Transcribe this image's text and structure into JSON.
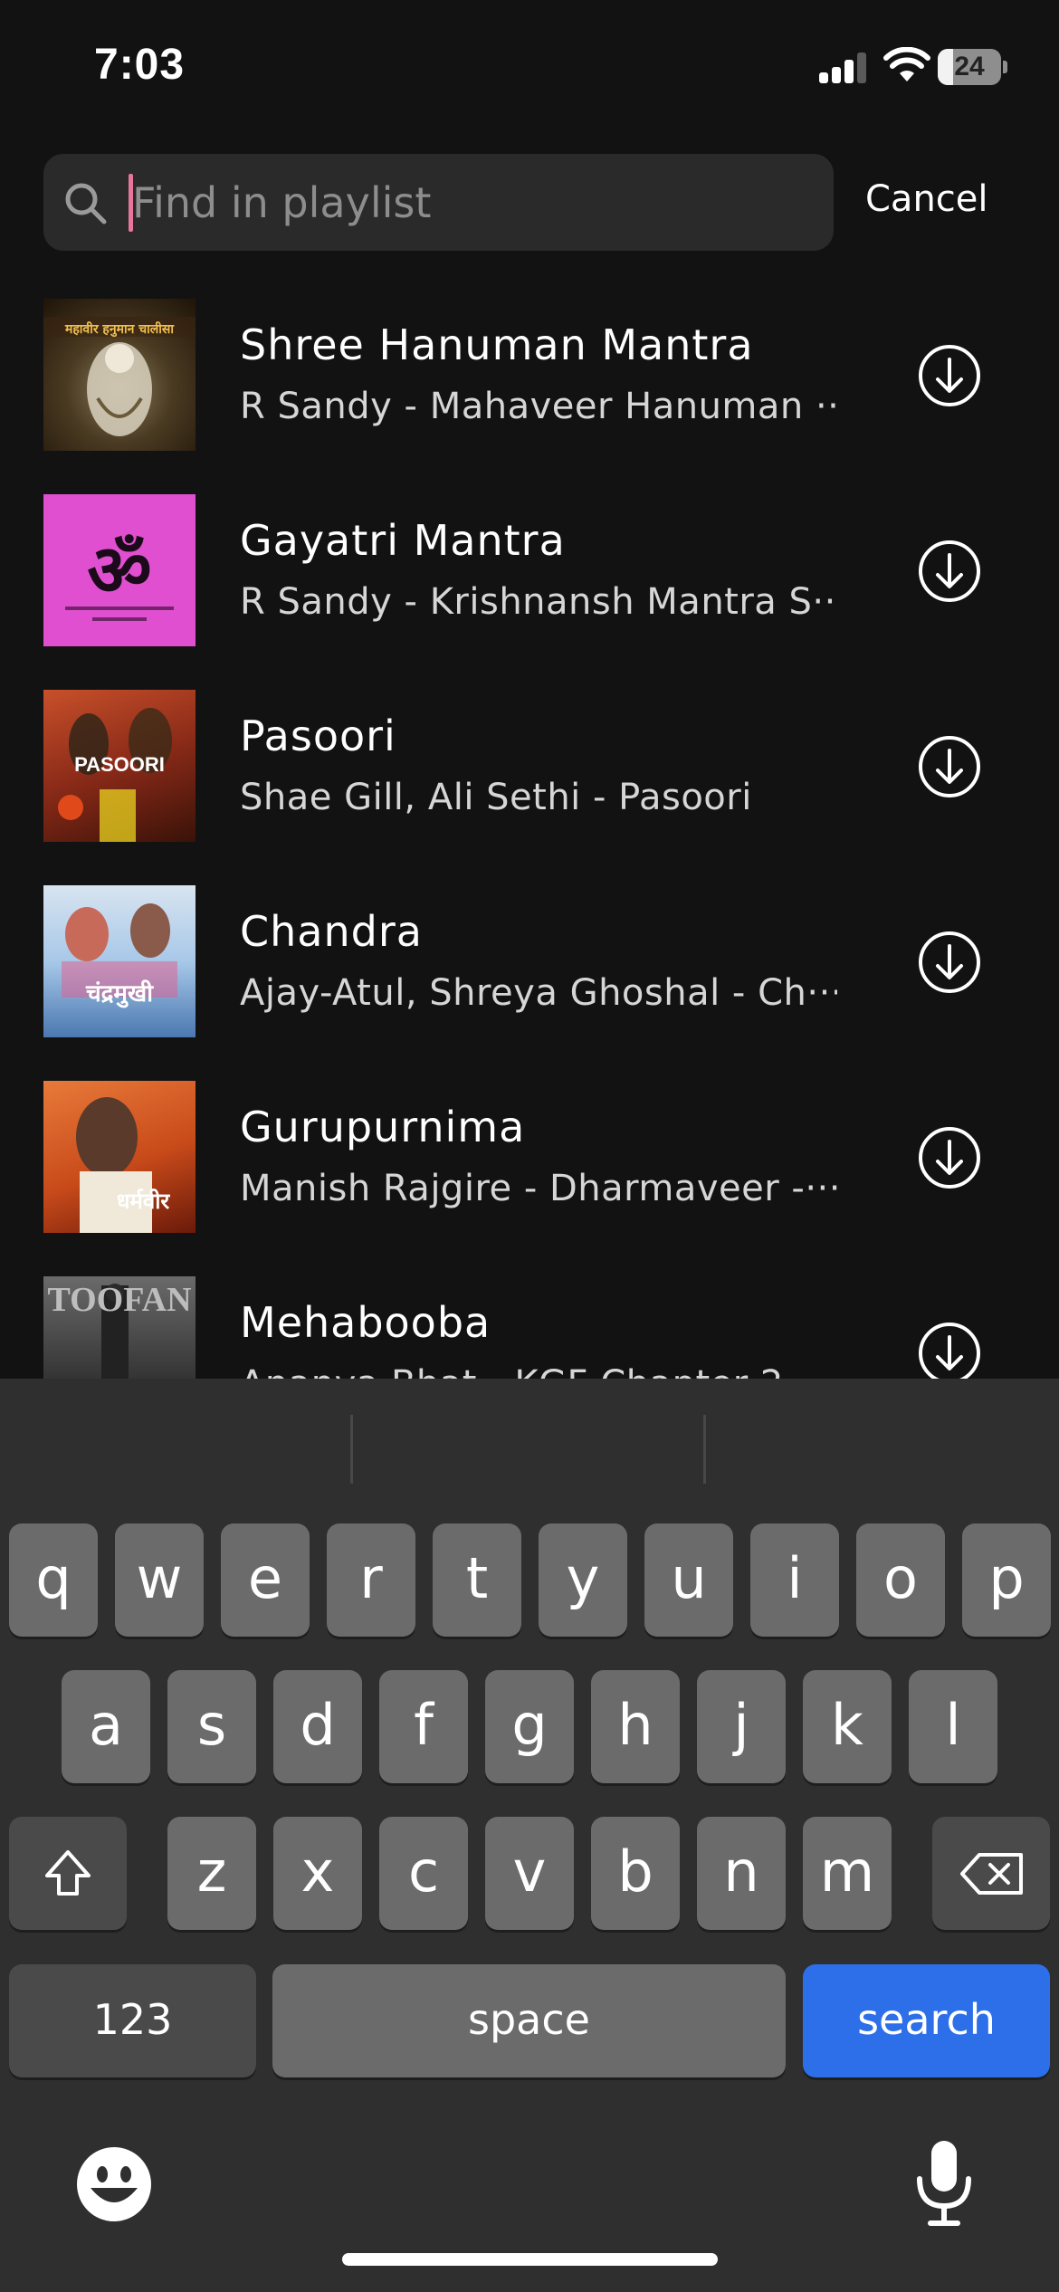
{
  "status_bar": {
    "time": "7:03",
    "battery": "24",
    "battery_level": 0.24
  },
  "search": {
    "placeholder": "Find in playlist",
    "value": "",
    "cancel_label": "Cancel"
  },
  "tracks": [
    {
      "title": "Shree Hanuman Mantra",
      "subtitle": "R Sandy - Mahaveer Hanuman ···",
      "art_text": "महावीर हनुमान चालीसा"
    },
    {
      "title": "Gayatri Mantra",
      "subtitle": "R Sandy - Krishnansh Mantra S···",
      "art_text": "ॐ"
    },
    {
      "title": "Pasoori",
      "subtitle": "Shae Gill, Ali Sethi - Pasoori",
      "art_text": "PASOORI"
    },
    {
      "title": "Chandra",
      "subtitle": "Ajay-Atul, Shreya Ghoshal - Ch···",
      "art_text": "चंद्रमुखी"
    },
    {
      "title": "Gurupurnima",
      "subtitle": "Manish Rajgire - Dharmaveer -···",
      "art_text": "धर्मवीर"
    },
    {
      "title": "Mehabooba",
      "subtitle": "Ananya Bhat - KGF Chapter 2",
      "art_text": "TOOFAN"
    }
  ],
  "keyboard": {
    "row1": [
      "q",
      "w",
      "e",
      "r",
      "t",
      "y",
      "u",
      "i",
      "o",
      "p"
    ],
    "row2": [
      "a",
      "s",
      "d",
      "f",
      "g",
      "h",
      "j",
      "k",
      "l"
    ],
    "row3": [
      "z",
      "x",
      "c",
      "v",
      "b",
      "n",
      "m"
    ],
    "numbers_label": "123",
    "space_label": "space",
    "search_label": "search"
  },
  "colors": {
    "background": "#121212",
    "keyboard_bg": "#2f2f2f",
    "key": "#6b6b6b",
    "key_dark": "#4a4a4a",
    "search_key": "#2c6fe8",
    "caret": "#e8769a"
  },
  "icons": {
    "search": "magnifying-glass",
    "download": "arrow-down-circle",
    "shift": "shift-arrow",
    "delete": "backspace",
    "emoji": "smiley-face",
    "mic": "microphone"
  }
}
